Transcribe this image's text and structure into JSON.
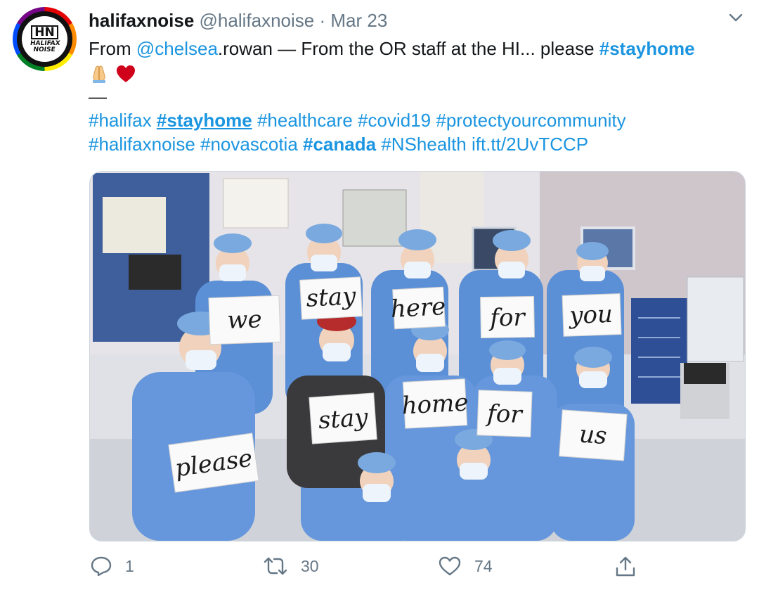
{
  "account": {
    "avatar_logo": "HN",
    "avatar_text": "HALIFAX NOISE",
    "display_name": "halifaxnoise",
    "handle": "@halifaxnoise",
    "separator": "·",
    "date": "Mar 23"
  },
  "tweet": {
    "line1": {
      "pre": "From ",
      "mention": "@chelsea",
      "mid": ".rowan — From the OR staff at the HI... please ",
      "hashtag": "#stayhome"
    },
    "line2_emojis": [
      "folded-hands-emoji",
      "red-heart-emoji"
    ],
    "line3": "—",
    "hashtags_line4": [
      "#halifax",
      "#stayhome",
      "#healthcare",
      "#covid19",
      "#protectyourcommunity"
    ],
    "hashtags_line5": [
      "#halifaxnoise",
      "#novascotia",
      "#canada",
      "#NShealth"
    ],
    "link": "ift.tt/2UvTCCP"
  },
  "media": {
    "signs": [
      "we",
      "stay",
      "here",
      "for",
      "you",
      "please",
      "stay",
      "home",
      "for",
      "us"
    ]
  },
  "actions": {
    "reply_count": "1",
    "retweet_count": "30",
    "like_count": "74"
  },
  "colors": {
    "link": "#1b95e0",
    "text": "#14171a",
    "muted": "#657786",
    "scrubs": "#5b8fd6",
    "heart": "#d0021b"
  }
}
